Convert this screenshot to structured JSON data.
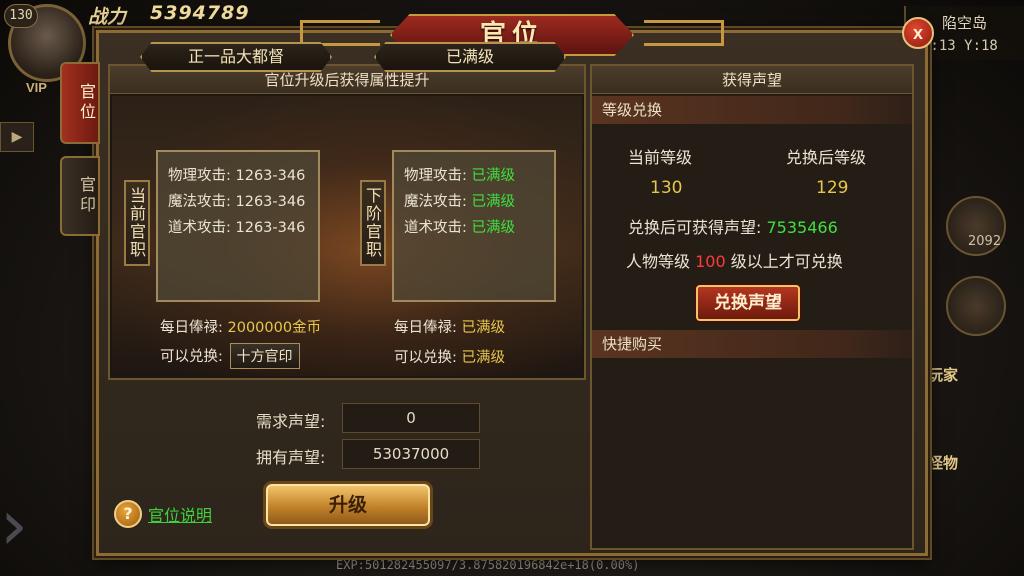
{
  "hud": {
    "level": "130",
    "vip": "VIP",
    "power_label": "战力",
    "power_value": "5394789",
    "map_name": "陷空岛",
    "coords": "X:13  Y:18",
    "side_count": "2092",
    "side_player": "玩家",
    "side_monster": "怪物",
    "exp": "EXP:501282455097/3.875820196842e+18(0.00%)"
  },
  "window": {
    "title": "官位",
    "close_symbol": "x",
    "tabs": [
      {
        "label": "官位",
        "active": true
      },
      {
        "label": "官印",
        "active": false
      }
    ]
  },
  "left_panel": {
    "header": "官位升级后获得属性提升",
    "current": {
      "rank_name": "正一品大都督",
      "side_label": "当前官职",
      "stats": [
        {
          "label": "物理攻击:",
          "value": "1263-346"
        },
        {
          "label": "魔法攻击:",
          "value": "1263-346"
        },
        {
          "label": "道术攻击:",
          "value": "1263-346"
        }
      ],
      "salary_label": "每日俸禄:",
      "salary_value": "2000000金币",
      "exchange_label": "可以兑换:",
      "exchange_value": "十方官印"
    },
    "next": {
      "rank_name": "已满级",
      "side_label": "下阶官职",
      "stats": [
        {
          "label": "物理攻击:",
          "value": "已满级"
        },
        {
          "label": "魔法攻击:",
          "value": "已满级"
        },
        {
          "label": "道术攻击:",
          "value": "已满级"
        }
      ],
      "salary_label": "每日俸禄:",
      "salary_value": "已满级",
      "exchange_label": "可以兑换:",
      "exchange_value": "已满级"
    }
  },
  "bottom": {
    "need_label": "需求声望:",
    "need_value": "0",
    "have_label": "拥有声望:",
    "have_value": "53037000",
    "help_symbol": "?",
    "help_link": "官位说明",
    "upgrade_button": "升级"
  },
  "right_panel": {
    "header": "获得声望",
    "section1": "等级兑换",
    "current_level_label": "当前等级",
    "after_level_label": "兑换后等级",
    "current_level": "130",
    "after_level": "129",
    "gain_label": "兑换后可获得声望:",
    "gain_value": "7535466",
    "req_prefix": "人物等级",
    "req_level": "100",
    "req_suffix": "级以上才可兑换",
    "exchange_button": "兑换声望",
    "section2": "快捷购买"
  },
  "colors": {
    "gold_text": "#e8c64c",
    "green_text": "#3fe03f",
    "red_text": "#ff3a3a",
    "frame_gold": "#8d6b34",
    "title_red": "#9c2a1f"
  }
}
